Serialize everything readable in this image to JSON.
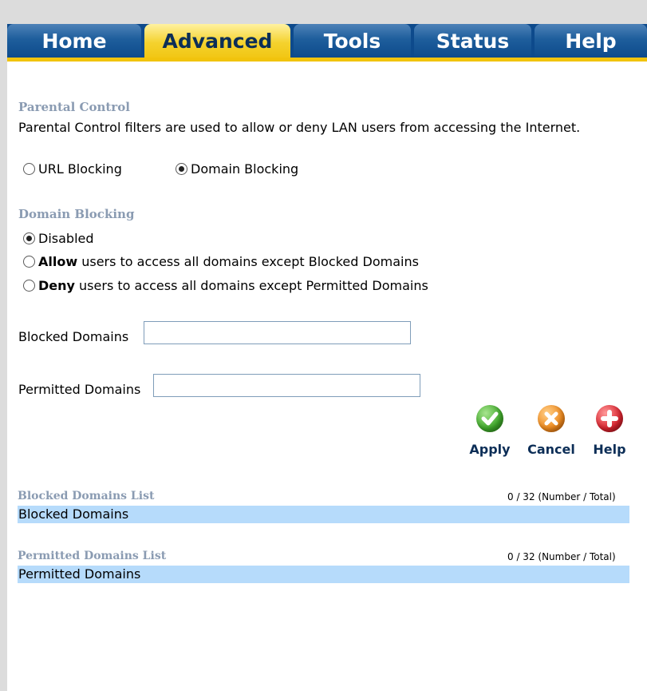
{
  "nav": {
    "tabs": [
      {
        "label": "Home",
        "active": false
      },
      {
        "label": "Advanced",
        "active": true
      },
      {
        "label": "Tools",
        "active": false
      },
      {
        "label": "Status",
        "active": false
      },
      {
        "label": "Help",
        "active": false
      }
    ]
  },
  "parental_control": {
    "title": "Parental Control",
    "description": "Parental Control filters are used to allow or deny LAN users from accessing the Internet.",
    "options": [
      {
        "label": "URL Blocking",
        "selected": false
      },
      {
        "label": "Domain Blocking",
        "selected": true
      }
    ]
  },
  "domain_blocking": {
    "title": "Domain Blocking",
    "options": [
      {
        "bold": "",
        "label": "Disabled",
        "selected": true
      },
      {
        "bold": "Allow",
        "label": " users to access all domains except Blocked Domains",
        "selected": false
      },
      {
        "bold": "Deny",
        "label": " users to access all domains except Permitted Domains",
        "selected": false
      }
    ]
  },
  "fields": {
    "blocked_label": "Blocked Domains",
    "blocked_value": "",
    "permitted_label": "Permitted Domains",
    "permitted_value": ""
  },
  "buttons": {
    "apply": "Apply",
    "cancel": "Cancel",
    "help": "Help"
  },
  "lists": {
    "blocked": {
      "title": "Blocked Domains List",
      "count": "0 / 32 (Number / Total)",
      "header": "Blocked Domains"
    },
    "permitted": {
      "title": "Permitted Domains List",
      "count": "0 / 32 (Number / Total)",
      "header": "Permitted Domains"
    }
  },
  "colors": {
    "nav_blue": "#0d4a8c",
    "nav_gold": "#f1c30d",
    "section_title": "#8a9bb2",
    "list_bar": "#b6dbfb",
    "apply_green": "#3fa82a",
    "cancel_orange": "#ef8a1e",
    "help_red": "#d9232e"
  }
}
